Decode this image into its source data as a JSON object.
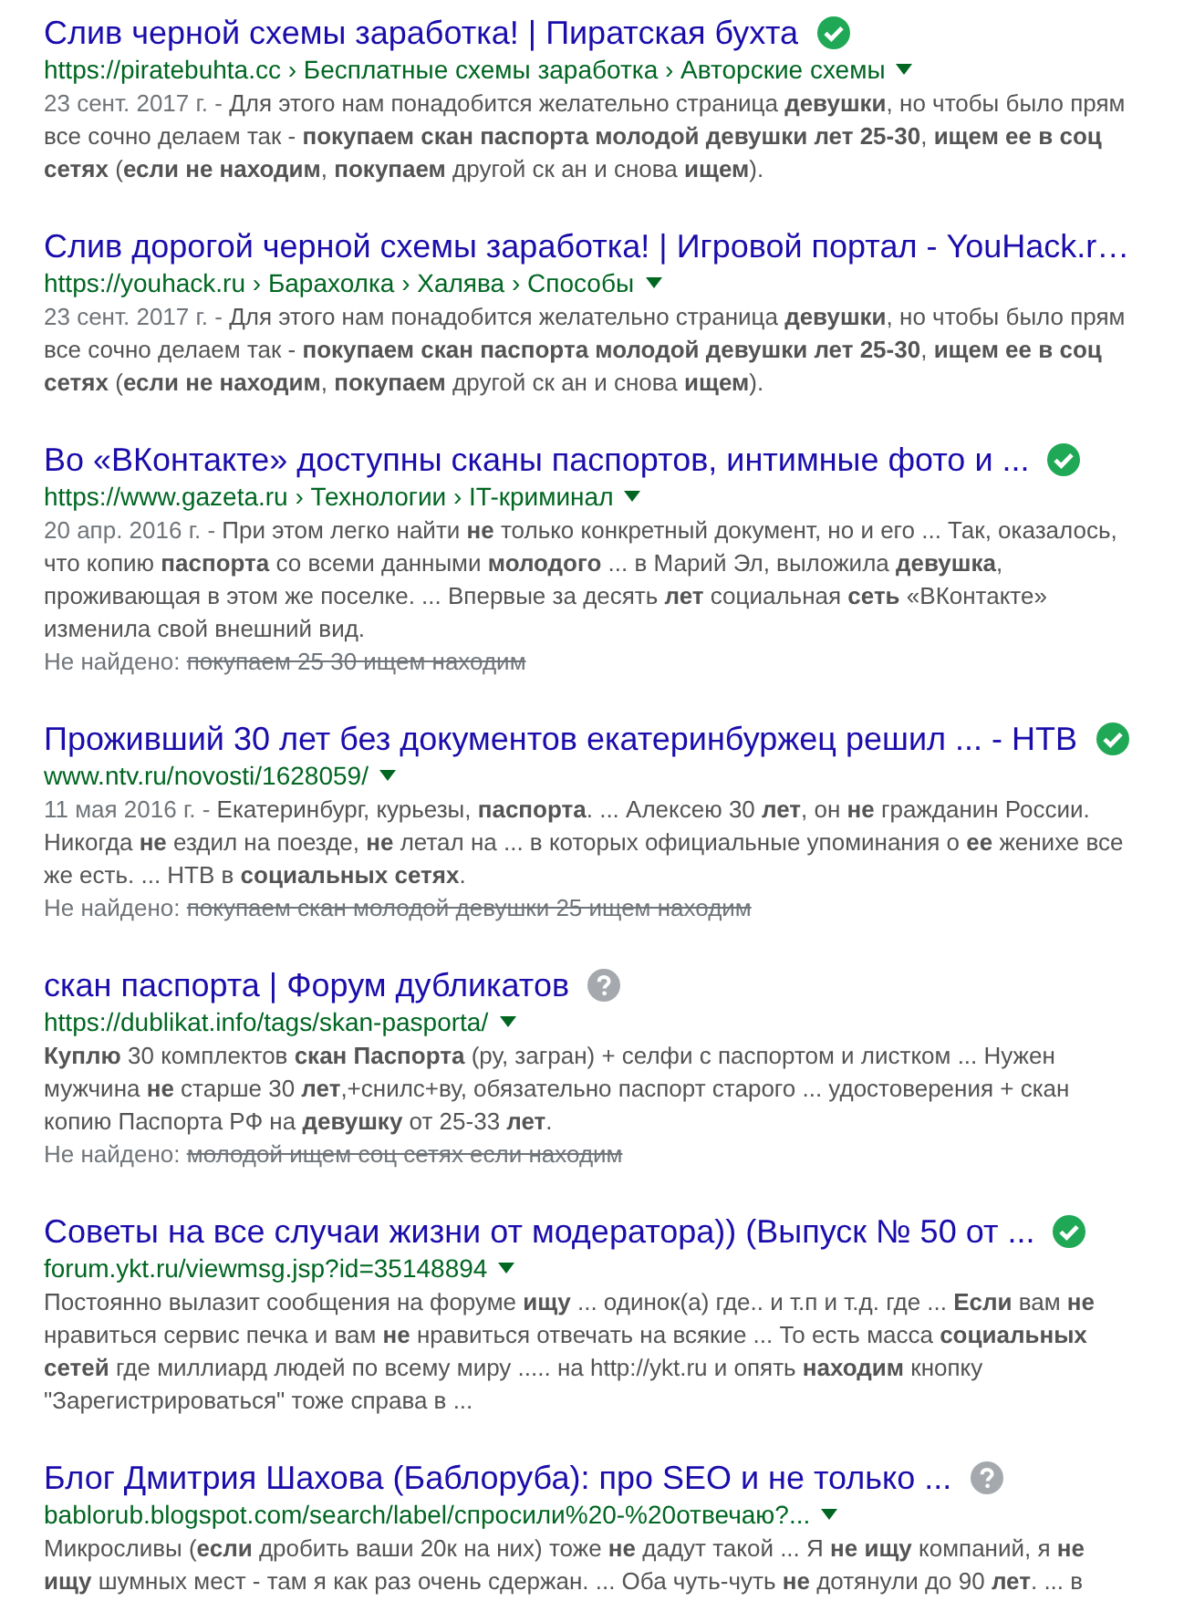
{
  "results": [
    {
      "title": "Слив черной схемы заработка! | Пиратская бухта",
      "kind": "verified",
      "url": "https://piratebuhta.cc › Бесплатные схемы заработка › Авторские схемы",
      "date": "23 сент. 2017 г. - ",
      "snippet": "Для этого нам понадобится желательно страница **девушки**, но чтобы было прям все сочно делаем так - **покупаем скан паспорта молодой девушки лет 25-30**, **ищем ее в соц сетях** (**если не находим**, **покупаем** другой ск ан и снова **ищем**)."
    },
    {
      "title": "Слив дорогой черной схемы заработка! | Игровой портал - YouHack.r…",
      "kind": "plain",
      "url": "https://youhack.ru › Барахолка › Халява › Способы",
      "date": "23 сент. 2017 г. - ",
      "snippet": "Для этого нам понадобится желательно страница **девушки**, но чтобы было прям все сочно делаем так - **покупаем скан паспорта молодой девушки лет 25-30**, **ищем ее в соц сетях** (**если не находим**, **покупаем** другой ск ан и снова **ищем**)."
    },
    {
      "title": "Во «ВКонтакте» доступны сканы паспортов, интимные фото и ...",
      "kind": "verified",
      "url": "https://www.gazeta.ru › Технологии › IT-криминал",
      "date": "20 апр. 2016 г. - ",
      "snippet": "При этом легко найти **не** только конкретный документ, но и его ... Так, оказалось, что копию **паспорта** со всеми данными **молодого** ... в Марий Эл, выложила **девушка**, проживающая в этом же поселке. ... Впервые за десять **лет** социальная **сеть** «ВКонтакте» изменила свой внешний вид.",
      "missing_label": "Не найдено:",
      "missing_terms": "покупаем 25 30 ищем находим"
    },
    {
      "title": "Проживший 30 лет без документов екатеринбуржец решил ... - НТВ",
      "kind": "verified",
      "url": "www.ntv.ru/novosti/1628059/",
      "date": "11 мая 2016 г. - ",
      "snippet": "Екатеринбург, курьезы, **паспорта**. ... Алексею 30 **лет**, он **не** гражданин России. Никогда **не** ездил на поезде, **не** летал на ... в которых официальные упоминания о **ее** женихе все же есть. ... НТВ в **социальных сетях**.",
      "missing_label": "Не найдено:",
      "missing_terms": "покупаем скан молодой девушки 25 ищем находим"
    },
    {
      "title": "скан паспорта | Форум дубликатов",
      "kind": "unknown",
      "url": "https://dublikat.info/tags/skan-pasporta/",
      "snippet": "**Куплю** 30 комплектов **скан Паспорта** (ру, загран) + селфи с паспортом и листком ... Нужен мужчина **не** старше 30 **лет**,+снилс+ву, обязательно паспорт старого ... удостоверения + скан копию Паспорта РФ на **девушку** от 25-33 **лет**.",
      "missing_label": "Не найдено:",
      "missing_terms": "молодой ищем соц сетях если находим"
    },
    {
      "title": "Советы на все случаи жизни от модератора)) (Выпуск № 50 от ...",
      "kind": "verified",
      "url": "forum.ykt.ru/viewmsg.jsp?id=35148894",
      "snippet": "Постоянно вылазит сообщения на форуме **ищу** ... одинок(а) где.. и т.п и т.д. где ... **Если** вам **не** нравиться сервис печка и вам **не** нравиться отвечать на всякие ... То есть масса **социальных сетей** где миллиард людей по всему миру ..... на http://ykt.ru и опять **находим** кнопку \"Зарегистрироваться\" тоже справа в ..."
    },
    {
      "title": "Блог Дмитрия Шахова (Баблоруба): про SEO и не только ...",
      "kind": "unknown",
      "url": "bablorub.blogspot.com/search/label/спросили%20-%20отвечаю?...",
      "snippet": "Микросливы (**если** дробить ваши 20к на них) тоже **не** дадут такой ... Я **не ищу** компаний, я **не ищу** шумных мест - там я как раз очень сдержан. ... Оба чуть-чуть **не** дотянули до 90 **лет**. ... в"
    }
  ]
}
